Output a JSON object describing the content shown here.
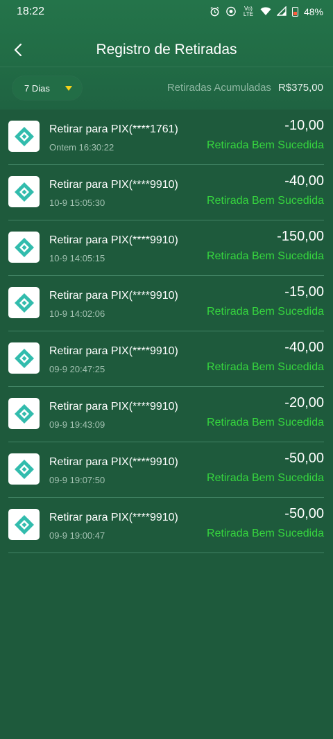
{
  "status_bar": {
    "time": "18:22",
    "network": "Vo) LTE",
    "battery": "48%",
    "icons": [
      "alarm-icon",
      "eye-icon",
      "wifi-icon",
      "signal-icon",
      "battery-icon"
    ]
  },
  "header": {
    "title": "Registro de Retiradas",
    "back_icon": "chevron-left-icon"
  },
  "filter": {
    "period": "7 Dias",
    "total_label": "Retiradas Acumuladas",
    "total_value": "R$375,00",
    "caret_color": "#f4d21a"
  },
  "colors": {
    "background": "#1e5a3c",
    "success": "#36d63e",
    "pix_logo": "#32bcad"
  },
  "withdrawals": [
    {
      "title": "Retirar para PIX(****1761)",
      "time": "Ontem 16:30:22",
      "amount": "-10,00",
      "status": "Retirada Bem Sucedida"
    },
    {
      "title": "Retirar para PIX(****9910)",
      "time": "10-9 15:05:30",
      "amount": "-40,00",
      "status": "Retirada Bem Sucedida"
    },
    {
      "title": "Retirar para PIX(****9910)",
      "time": "10-9 14:05:15",
      "amount": "-150,00",
      "status": "Retirada Bem Sucedida"
    },
    {
      "title": "Retirar para PIX(****9910)",
      "time": "10-9 14:02:06",
      "amount": "-15,00",
      "status": "Retirada Bem Sucedida"
    },
    {
      "title": "Retirar para PIX(****9910)",
      "time": "09-9 20:47:25",
      "amount": "-40,00",
      "status": "Retirada Bem Sucedida"
    },
    {
      "title": "Retirar para PIX(****9910)",
      "time": "09-9 19:43:09",
      "amount": "-20,00",
      "status": "Retirada Bem Sucedida"
    },
    {
      "title": "Retirar para PIX(****9910)",
      "time": "09-9 19:07:50",
      "amount": "-50,00",
      "status": "Retirada Bem Sucedida"
    },
    {
      "title": "Retirar para PIX(****9910)",
      "time": "09-9 19:00:47",
      "amount": "-50,00",
      "status": "Retirada Bem Sucedida"
    }
  ]
}
